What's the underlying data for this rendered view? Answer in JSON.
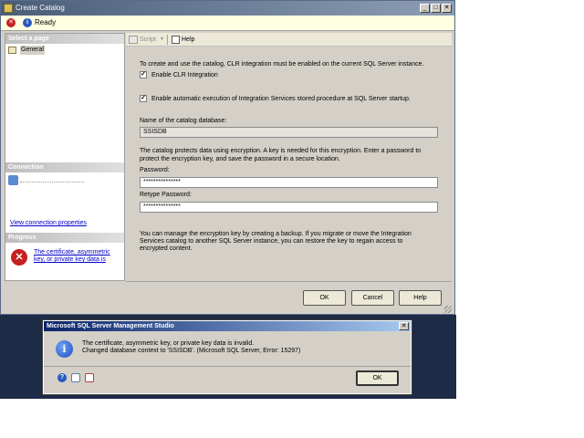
{
  "main_window": {
    "title": "Create Catalog",
    "status": "Ready"
  },
  "left_panel": {
    "select_page_header": "Select a page",
    "pages": [
      {
        "label": "General"
      }
    ],
    "connection_header": "Connection",
    "view_connection_properties": "View connection properties",
    "progress_header": "Progress",
    "progress_message": [
      "The certificate, asymmetric",
      "key, or private key data is"
    ]
  },
  "toolbar": {
    "script_label": "Script",
    "help_label": "Help"
  },
  "content": {
    "intro": "To create and use the catalog, CLR integration must be enabled on the current SQL Server instance.",
    "enable_clr_label": "Enable CLR Integration",
    "enable_clr_checked": true,
    "auto_exec_label": "Enable automatic execution of Integration Services stored procedure at SQL Server startup.",
    "auto_exec_checked": true,
    "catalog_name_label": "Name of the catalog database:",
    "catalog_name_value": "SSISDB",
    "encryption_note": [
      "The catalog protects data using encryption. A key is needed for this encryption. Enter a password to",
      "protect the encryption key, and save the password in a secure location."
    ],
    "password_label": "Password:",
    "password_value": "***************",
    "retype_label": "Retype Password:",
    "retype_value": "***************",
    "backup_note": [
      "You can manage the encryption key by creating a backup. If you migrate or move the Integration",
      "Services catalog to another SQL Server instance, you can restore the key to regain access to",
      "encrypted content."
    ]
  },
  "buttons": {
    "ok": "OK",
    "cancel": "Cancel",
    "help": "Help"
  },
  "error_dialog": {
    "title": "Microsoft SQL Server Management Studio",
    "message_line1": "The certificate, asymmetric key, or private key data is invalid.",
    "message_line2": "Changed database context to 'SSISDB'. (Microsoft SQL Server, Error: 15297)",
    "ok": "OK",
    "icons": [
      "help-icon",
      "copy-icon",
      "details-icon"
    ]
  },
  "colors": {
    "titlebar_main": "#4a5d78",
    "titlebar_dialog": "#0a246a",
    "desktop": "#1d2b47",
    "link": "#0000cc",
    "error_red": "#c62020",
    "info_blue": "#2a59c0"
  }
}
